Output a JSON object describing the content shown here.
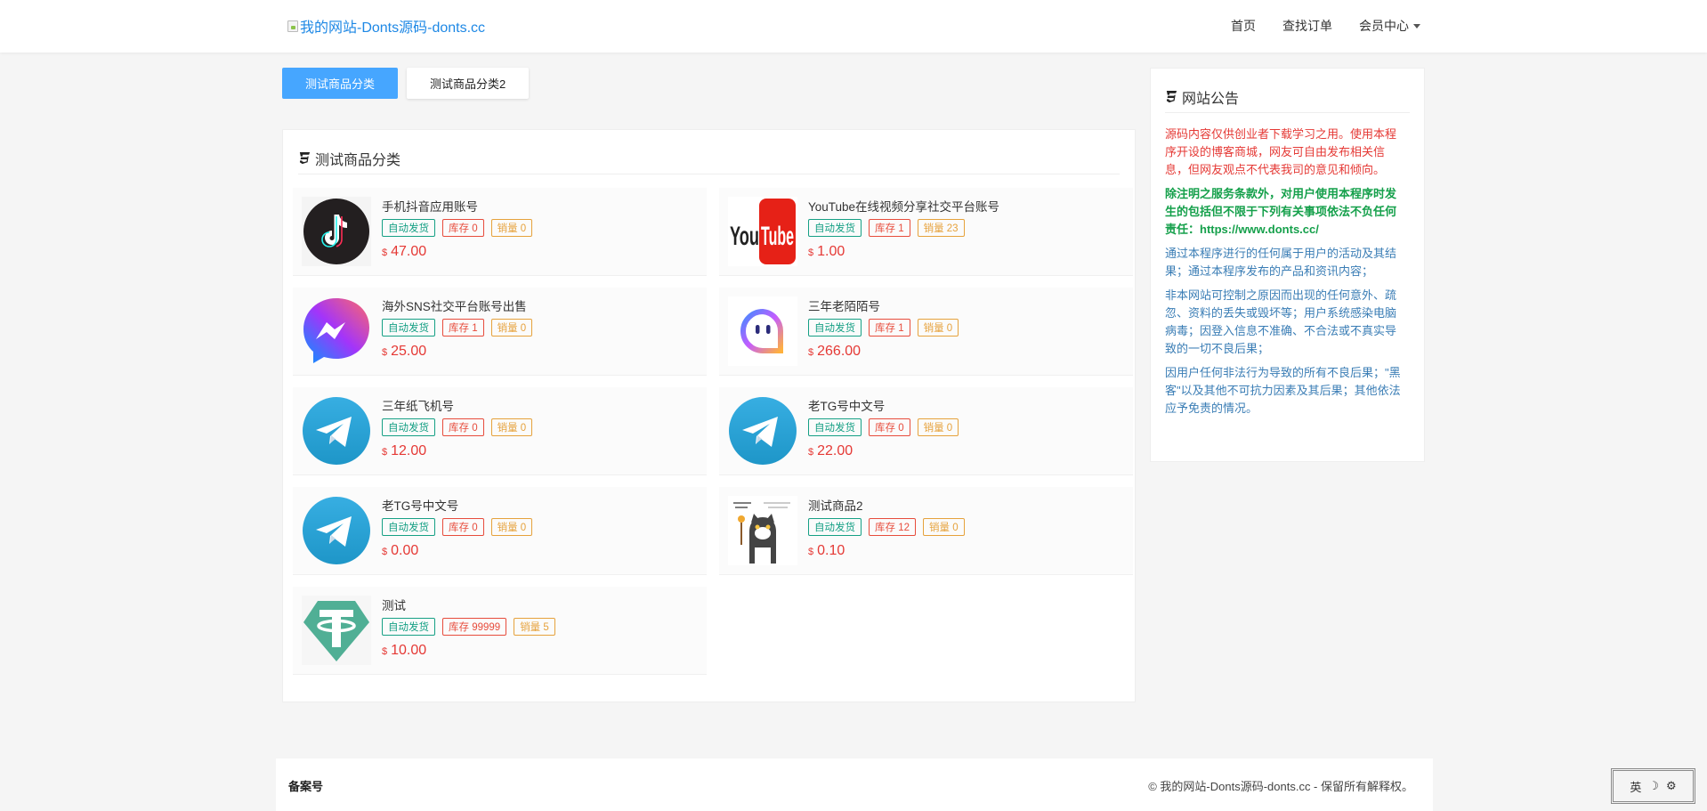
{
  "header": {
    "brand": "我的网站-Donts源码-donts.cc",
    "nav": [
      "首页",
      "查找订单",
      "会员中心"
    ]
  },
  "category_tabs": [
    "测试商品分类",
    "测试商品分类2"
  ],
  "panel": {
    "title": "测试商品分类",
    "products": [
      {
        "name": "手机抖音应用账号",
        "badge_auto": "自动发货",
        "stock": "库存 0",
        "sales": "销量 0",
        "currency": "$",
        "price": "47.00",
        "icon": "tiktok-icon"
      },
      {
        "name": "YouTube在线视频分享社交平台账号",
        "badge_auto": "自动发货",
        "stock": "库存 1",
        "sales": "销量 23",
        "currency": "$",
        "price": "1.00",
        "icon": "youtube-icon"
      },
      {
        "name": "海外SNS社交平台账号出售",
        "badge_auto": "自动发货",
        "stock": "库存 1",
        "sales": "销量 0",
        "currency": "$",
        "price": "25.00",
        "icon": "messenger-icon"
      },
      {
        "name": "三年老陌陌号",
        "badge_auto": "自动发货",
        "stock": "库存 1",
        "sales": "销量 0",
        "currency": "$",
        "price": "266.00",
        "icon": "momo-icon"
      },
      {
        "name": "三年纸飞机号",
        "badge_auto": "自动发货",
        "stock": "库存 0",
        "sales": "销量 0",
        "currency": "$",
        "price": "12.00",
        "icon": "telegram-icon"
      },
      {
        "name": "老TG号中文号",
        "badge_auto": "自动发货",
        "stock": "库存 0",
        "sales": "销量 0",
        "currency": "$",
        "price": "22.00",
        "icon": "telegram-icon"
      },
      {
        "name": "老TG号中文号",
        "badge_auto": "自动发货",
        "stock": "库存 0",
        "sales": "销量 0",
        "currency": "$",
        "price": "0.00",
        "icon": "telegram-icon"
      },
      {
        "name": "测试商品2",
        "badge_auto": "自动发货",
        "stock": "库存 12",
        "sales": "销量 0",
        "currency": "$",
        "price": "0.10",
        "icon": "cat-meme-image"
      },
      {
        "name": "测试",
        "badge_auto": "自动发货",
        "stock": "库存 99999",
        "sales": "销量 5",
        "currency": "$",
        "price": "10.00",
        "icon": "tether-icon"
      }
    ]
  },
  "notice": {
    "title": "网站公告",
    "paragraphs": [
      "源码内容仅供创业者下载学习之用。使用本程序开设的博客商城，网友可自由发布相关信息，但网友观点不代表我司的意见和倾向。",
      "除注明之服务条款外，对用户使用本程序时发生的包括但不限于下列有关事项依法不负任何责任：https://www.donts.cc/",
      "通过本程序进行的任何属于用户的活动及其结果；通过本程序发布的产品和资讯内容；",
      "非本网站可控制之原因而出现的任何意外、疏忽、资料的丢失或毁坏等；用户系统感染电脑病毒；因登入信息不准确、不合法或不真实导致的一切不良后果；",
      "因用户任何非法行为导致的所有不良后果；\"黑客\"以及其他不可抗力因素及其后果；其他依法应予免责的情况。"
    ]
  },
  "footer": {
    "left": "备案号",
    "right": "© 我的网站-Donts源码-donts.cc - 保留所有解释权。"
  },
  "lang_toolbar": [
    "英",
    "☽",
    "⚙"
  ],
  "colors": {
    "accent": "#46a6ff",
    "price": "#e53935",
    "badge_auto": "#16a085",
    "badge_stock": "#e74c3c",
    "badge_sales": "#e6a23c"
  }
}
